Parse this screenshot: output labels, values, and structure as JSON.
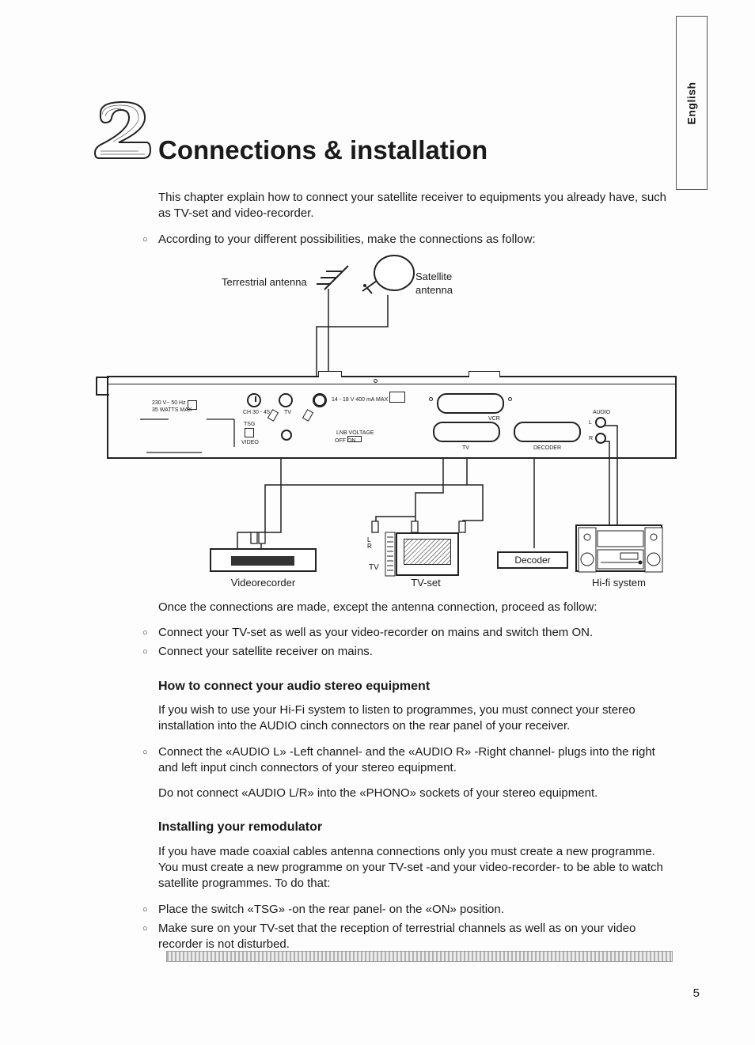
{
  "side_tab": {
    "label": "English"
  },
  "chapter": {
    "number": "2",
    "title": "Connections & installation"
  },
  "intro": "This chapter explain how to connect your satellite receiver to equipments you already have, such as TV-set and video-recorder.",
  "bullet_intro": "According to your different possibilities, make the connections as follow:",
  "diagram": {
    "terrestrial_label": "Terrestrial antenna",
    "satellite_label": "Satellite\nantenna",
    "receiver": {
      "power_spec": "230 V~ 50 Hz\n35 WATTS MAX",
      "ch_label": "CH 30 - 45",
      "tv_port": "TV",
      "tsg_label": "TSG",
      "video_label": "VIDEO",
      "lnb_spec": "14 - 18 V 400 mA MAX",
      "lnb_voltage": "LNB VOLTAGE",
      "lnb_off_on": "OFF        ON",
      "vcr_label": "VCR",
      "tv_scart_label": "TV",
      "decoder_label": "DECODER",
      "audio_label": "AUDIO",
      "audio_l": "L",
      "audio_r": "R"
    },
    "devices": {
      "videorecorder": "Videorecorder",
      "tv_small": "TV",
      "tvset": "TV-set",
      "decoder": "Decoder",
      "hifi": "Hi-fi system"
    }
  },
  "post_diagram": "Once the connections are made, except the antenna connection, proceed as follow:",
  "post_bullets": [
    "Connect your TV-set as well as your video-recorder on mains and switch them ON.",
    "Connect your satellite receiver on mains."
  ],
  "audio_section": {
    "heading": "How to connect your audio stereo equipment",
    "p1": "If you wish to use your Hi-Fi system to listen to programmes, you must connect your stereo installation into the AUDIO cinch connectors on the rear panel of your receiver.",
    "bullet": "Connect the «AUDIO L» -Left channel- and the «AUDIO R» -Right channel- plugs into the right and left input cinch connectors of your stereo equipment.",
    "p2": "Do not connect «AUDIO L/R» into the «PHONO» sockets of your stereo equipment."
  },
  "remod_section": {
    "heading": "Installing your remodulator",
    "p1": "If you have made coaxial cables antenna connections only you must create a new programme. You must create a new programme on your TV-set -and your video-recorder- to be able to watch satellite programmes. To do that:",
    "bullets": [
      "Place the switch «TSG» -on the rear panel- on the «ON» position.",
      "Make sure on your TV-set that the reception of terrestrial channels as well as on your video recorder is not disturbed."
    ]
  },
  "page_number": "5"
}
